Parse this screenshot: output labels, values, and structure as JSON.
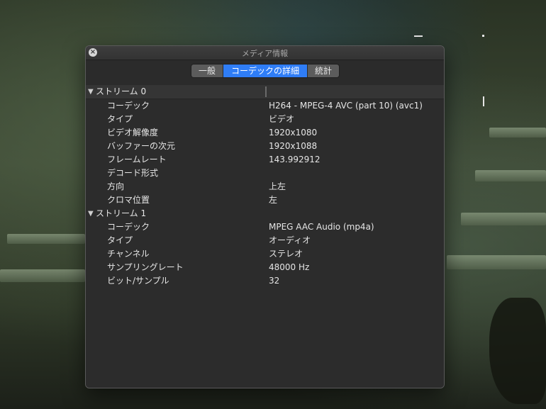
{
  "window": {
    "title": "メディア情報",
    "close_icon": "close-icon"
  },
  "tabs": [
    {
      "label": "一般",
      "active": false
    },
    {
      "label": "コーデックの詳細",
      "active": true
    },
    {
      "label": "統計",
      "active": false
    }
  ],
  "streams": [
    {
      "label": "ストリーム 0",
      "properties": [
        {
          "name": "コーデック",
          "value": "H264 - MPEG-4 AVC (part 10) (avc1)"
        },
        {
          "name": "タイプ",
          "value": "ビデオ"
        },
        {
          "name": "ビデオ解像度",
          "value": "1920x1080"
        },
        {
          "name": "バッファーの次元",
          "value": "1920x1088"
        },
        {
          "name": "フレームレート",
          "value": "143.992912"
        },
        {
          "name": "デコード形式",
          "value": ""
        },
        {
          "name": "方向",
          "value": "上左"
        },
        {
          "name": "クロマ位置",
          "value": "左"
        }
      ]
    },
    {
      "label": "ストリーム 1",
      "properties": [
        {
          "name": "コーデック",
          "value": "MPEG AAC Audio (mp4a)"
        },
        {
          "name": "タイプ",
          "value": "オーディオ"
        },
        {
          "name": "チャンネル",
          "value": "ステレオ"
        },
        {
          "name": "サンプリングレート",
          "value": "48000 Hz"
        },
        {
          "name": "ビット/サンプル",
          "value": "32"
        }
      ]
    }
  ],
  "colors": {
    "active_tab": "#2f7df6",
    "window_bg": "#2b2b2b"
  }
}
